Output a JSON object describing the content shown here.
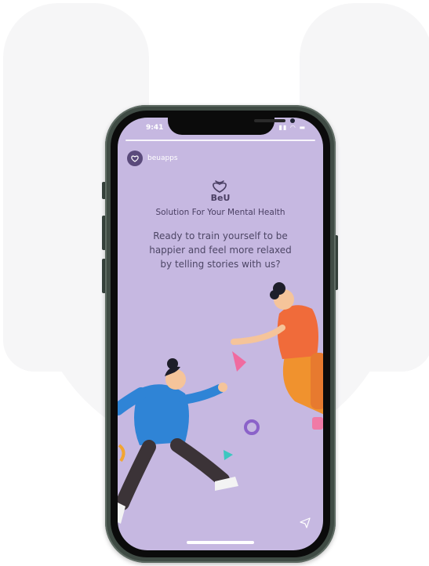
{
  "status_bar": {
    "time": "9:41"
  },
  "account": {
    "handle": "beuapps"
  },
  "brand": {
    "name": "BeU"
  },
  "tagline": "Solution For Your Mental Health",
  "description": "Ready to train yourself to be happier and feel more relaxed by telling stories with us?",
  "colors": {
    "screen_bg": "#c6b8e1",
    "phone_frame": "#3f4b44",
    "text_primary": "#4a3f63",
    "figure_blue": "#2f84d6",
    "figure_orange": "#f07a2a",
    "accent_pink": "#f06ba0"
  },
  "icons": [
    "beu-logo-icon",
    "avatar-icon",
    "share-icon",
    "signal-icon",
    "wifi-icon",
    "battery-icon"
  ]
}
